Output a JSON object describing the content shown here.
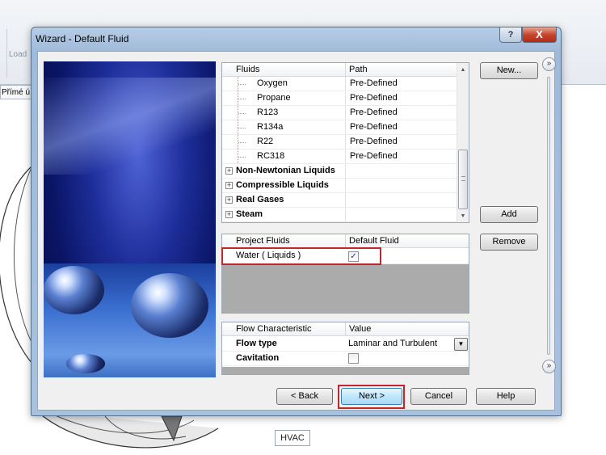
{
  "background": {
    "toolbar_label": "Load",
    "strip_label": "Přímé ú",
    "hvac_label": "HVAC"
  },
  "dialog": {
    "title": "Wizard - Default Fluid",
    "help_button": "?",
    "close_button": "X"
  },
  "fluids_table": {
    "col_fluids": "Fluids",
    "col_path": "Path",
    "rows": [
      {
        "name": "Oxygen",
        "path": "Pre-Defined"
      },
      {
        "name": "Propane",
        "path": "Pre-Defined"
      },
      {
        "name": "R123",
        "path": "Pre-Defined"
      },
      {
        "name": "R134a",
        "path": "Pre-Defined"
      },
      {
        "name": "R22",
        "path": "Pre-Defined"
      },
      {
        "name": "RC318",
        "path": "Pre-Defined"
      }
    ],
    "groups": [
      "Non-Newtonian Liquids",
      "Compressible Liquids",
      "Real Gases",
      "Steam"
    ],
    "expand_symbol": "+"
  },
  "project_fluids": {
    "col_project": "Project Fluids",
    "col_default": "Default Fluid",
    "rows": [
      {
        "name": "Water ( Liquids )",
        "default": true
      }
    ]
  },
  "flow": {
    "col_characteristic": "Flow Characteristic",
    "col_value": "Value",
    "flow_type_label": "Flow type",
    "flow_type_value": "Laminar and Turbulent",
    "cavitation_label": "Cavitation",
    "cavitation_checked": false
  },
  "buttons": {
    "new": "New...",
    "add": "Add",
    "remove": "Remove",
    "back": "< Back",
    "next": "Next >",
    "cancel": "Cancel",
    "help": "Help"
  },
  "collapse_icons": {
    "top": "»",
    "bottom": "»"
  },
  "colors": {
    "highlight": "#c0272d",
    "primary_button": "#bee6fd",
    "dialog_frame": "#a8c2de"
  }
}
